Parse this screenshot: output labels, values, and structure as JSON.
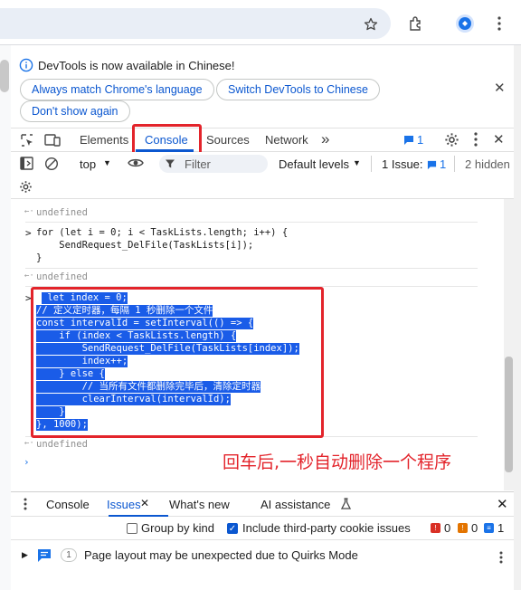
{
  "browser": {
    "icons": [
      "star-icon",
      "extensions-icon",
      "profile-icon",
      "more-vert-icon"
    ]
  },
  "infobar": {
    "message": "DevTools is now available in Chinese!",
    "btn_match": "Always match Chrome's language",
    "btn_switch": "Switch DevTools to Chinese",
    "btn_dont_show": "Don't show again",
    "close": "✕"
  },
  "devtools": {
    "tabs": [
      "Elements",
      "Console",
      "Sources",
      "Network"
    ],
    "more_tabs": "»",
    "issues_badge": "1",
    "close": "✕"
  },
  "console_toolbar": {
    "context": "top",
    "filter_placeholder": "Filter",
    "levels": "Default levels",
    "issues_label": "1 Issue:",
    "issues_count": "1",
    "hidden": "2 hidden"
  },
  "console": {
    "undefined_label": "undefined",
    "for_loop": [
      "for (let i = 0; i < TaskLists.length; i++) {",
      "    SendRequest_DelFile(TaskLists[i]);",
      "}"
    ],
    "selected_code": [
      " let index = 0;",
      "// 定义定时器，每隔 1 秒删除一个文件",
      "const intervalId = setInterval(() => {",
      "    if (index < TaskLists.length) {",
      "        SendRequest_DelFile(TaskLists[index]);",
      "        index++;",
      "    } else {",
      "        // 当所有文件都删除完毕后，清除定时器",
      "        clearInterval(intervalId);",
      "    }",
      "}, 1000);"
    ],
    "annotation": "回车后,一秒自动删除一个程序"
  },
  "drawer": {
    "tabs": [
      "Console",
      "Issues",
      "What's new",
      "AI assistance"
    ],
    "close": "✕",
    "group_by_kind": "Group by kind",
    "third_party": "Include third-party cookie issues",
    "count_errors": "0",
    "count_warnings": "0",
    "count_info": "1",
    "issue_count": "1",
    "issue_text": "Page layout may be unexpected due to Quirks Mode"
  },
  "colors": {
    "accent": "#0b57d0",
    "annotation_red": "#e3242b",
    "selection": "#1a5ce8"
  }
}
